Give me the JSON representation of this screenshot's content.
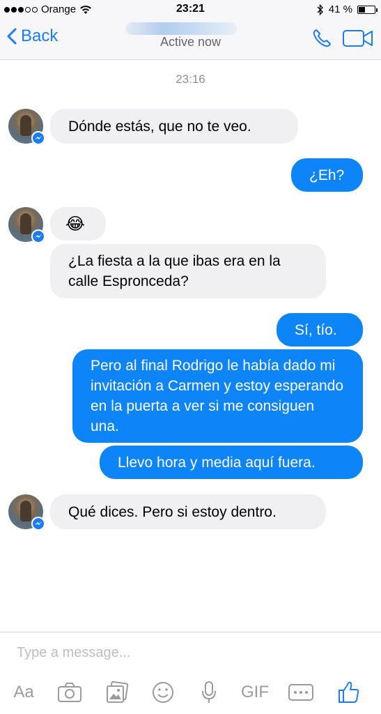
{
  "status_bar": {
    "carrier": "Orange",
    "time": "23:21",
    "battery_percent": "41 %",
    "battery_level": 0.41
  },
  "nav": {
    "back_label": "Back",
    "subtitle": "Active now"
  },
  "chat": {
    "timestamp": "23:16",
    "messages": [
      {
        "from": "them",
        "text": "Dónde estás, que no te veo."
      },
      {
        "from": "me",
        "text": "¿Eh?"
      },
      {
        "from": "them",
        "text": "😂"
      },
      {
        "from": "them",
        "text": "¿La fiesta a la que ibas era en la calle Espronceda?"
      },
      {
        "from": "me",
        "text": "Sí, tío."
      },
      {
        "from": "me",
        "text": "Pero al final Rodrigo le había dado mi invitación a Carmen y estoy esperando en la puerta a ver si me consiguen una."
      },
      {
        "from": "me",
        "text": "Llevo hora y media aquí fuera."
      },
      {
        "from": "them",
        "text": "Qué dices. Pero si estoy dentro."
      }
    ]
  },
  "composer": {
    "placeholder": "Type a message...",
    "text_format_label": "Aa",
    "gif_label": "GIF"
  },
  "icons": {
    "back": "chevron-left-icon",
    "call": "phone-icon",
    "video": "video-camera-icon",
    "camera": "camera-icon",
    "gallery": "gallery-icon",
    "emoji": "emoji-icon",
    "mic": "microphone-icon",
    "more": "more-icon",
    "like": "thumbs-up-icon"
  },
  "colors": {
    "accent": "#0d84f8",
    "incoming_bubble": "#f0f0f2"
  }
}
